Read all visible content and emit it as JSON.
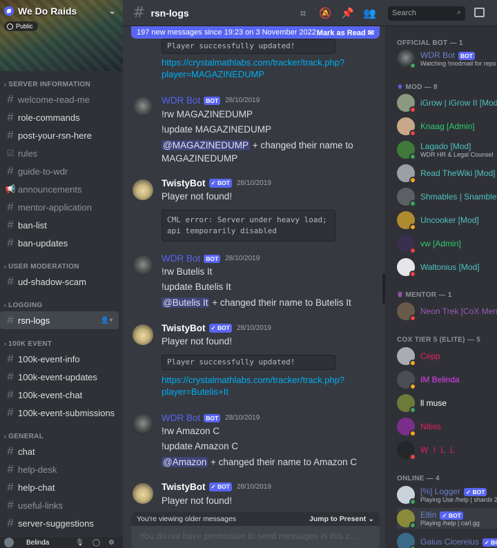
{
  "server": {
    "name": "We Do Raids",
    "public_label": "Public"
  },
  "categories": [
    {
      "name": "Server information",
      "channels": [
        "welcome-read-me",
        "role-commands",
        "post-your-rsn-here",
        "rules",
        "guide-to-wdr",
        "announcements",
        "mentor-application",
        "ban-list",
        "ban-updates"
      ]
    },
    {
      "name": "User moderation",
      "channels": [
        "ud-shadow-scam"
      ]
    },
    {
      "name": "Logging",
      "channels": [
        "rsn-logs"
      ]
    },
    {
      "name": "100k event",
      "channels": [
        "100k-event-info",
        "100k-event-updates",
        "100k-event-chat",
        "100k-event-submissions"
      ]
    },
    {
      "name": "General",
      "channels": [
        "chat",
        "help-desk",
        "help-chat",
        "useful-links",
        "server-suggestions"
      ]
    }
  ],
  "user": {
    "name": "Belinda"
  },
  "header": {
    "channel": "rsn-logs",
    "search_placeholder": "Search"
  },
  "new_messages": {
    "text": "197 new messages since 19:23 on 3 November 2022",
    "mark_read": "Mark as Read"
  },
  "messages": {
    "code0": "Player successfully updated!",
    "link0": "https://crystalmathlabs.com/tracker/track.php?player=MAGAZINEDUMP",
    "m1": {
      "author": "WDR Bot",
      "badge": "BOT",
      "time": "28/10/2019",
      "l1": "!rw MAGAZINEDUMP",
      "l2": "!update MAGAZINEDUMP",
      "mention": "@MAGAZINEDUMP",
      "l3": " + changed their name to MAGAZINEDUMP"
    },
    "m2": {
      "author": "TwistyBot",
      "badge": "✓ BOT",
      "time": "28/10/2019",
      "l1": "Player not found!",
      "code": "CML error: Server under heavy load; api temporarily disabled"
    },
    "m3": {
      "author": "WDR Bot",
      "badge": "BOT",
      "time": "28/10/2019",
      "l1": "!rw Butelis It",
      "l2": "!update Butelis It",
      "mention": "@Butelis It",
      "l3": " + changed their name to Butelis It"
    },
    "m4": {
      "author": "TwistyBot",
      "badge": "✓ BOT",
      "time": "28/10/2019",
      "l1": "Player not found!",
      "code": "Player successfully updated!",
      "link": "https://crystalmathlabs.com/tracker/track.php?player=Butelis+It"
    },
    "m5": {
      "author": "WDR Bot",
      "badge": "BOT",
      "time": "28/10/2019",
      "l1": "!rw Amazon C",
      "l2": "!update Amazon C",
      "mention": "@Amazon",
      "l3": " + changed their name to Amazon C"
    },
    "m6": {
      "author": "TwistyBot",
      "badge": "✓ BOT",
      "time": "28/10/2019",
      "l1": "Player not found!"
    }
  },
  "older_bar": {
    "text": "You're viewing older messages",
    "jump": "Jump to Present"
  },
  "composer": {
    "placeholder": "You do not have permission to send messages in this c..."
  },
  "member_list": {
    "official": {
      "title": "Official bot — 1",
      "name": "WDR Bot",
      "badge": "BOT",
      "status": "Watching !modmail for repo"
    },
    "mod": {
      "title": "Mod — 8",
      "members": [
        "iGrow | iGrow II [Mod]",
        "Knaag [Admin]",
        "Lagado [Mod]",
        "Read TheWiki [Mod]",
        "Shmables | Snambles",
        "Uncooker [Mod]",
        "vw [Admin]",
        "Waltonius [Mod]"
      ],
      "lagado_status": "WDR HR & Legal Counsel"
    },
    "mentor": {
      "title": "Mentor — 1",
      "members": [
        "Neon Trek [CoX Men"
      ]
    },
    "cox": {
      "title": "CoX Tier 5 (Elite) — 5",
      "members": [
        "Cepp",
        "IM Belinda",
        "ll muse",
        "Nibss",
        "W I L L"
      ]
    },
    "online": {
      "title": "Online — 4",
      "members": [
        {
          "name": "[%] Logger",
          "badge": "✓ BOT",
          "status": "Playing Use /help | shards 2"
        },
        {
          "name": "Eltin",
          "badge": "✓ BOT",
          "status": "Playing /help | carl.gg"
        },
        {
          "name": "Gaius Cicereius",
          "badge": "✓ BOT",
          "status": ""
        }
      ]
    }
  },
  "colors": {
    "blurple": "#5865f2",
    "link": "#00aff4",
    "bg": "#36393f",
    "sidebar": "#2f3136"
  }
}
